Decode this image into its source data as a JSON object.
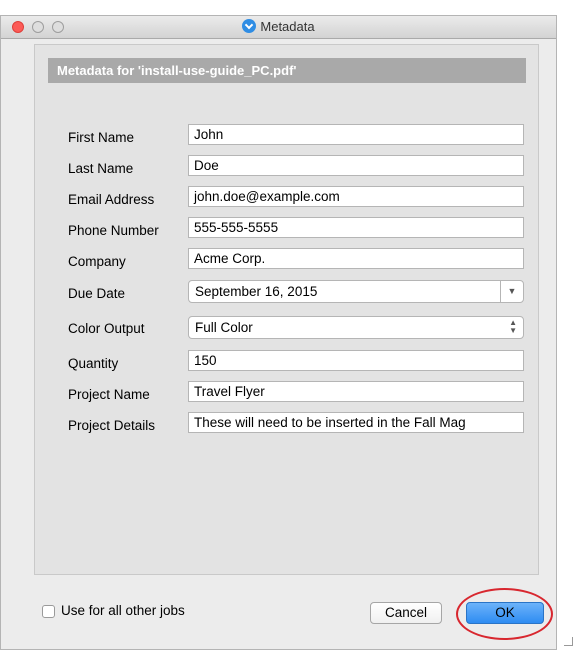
{
  "window": {
    "title": "Metadata"
  },
  "panel": {
    "header": "Metadata for 'install-use-guide_PC.pdf'"
  },
  "fields": {
    "first_name": {
      "label": "First Name",
      "value": "John"
    },
    "last_name": {
      "label": "Last Name",
      "value": "Doe"
    },
    "email": {
      "label": "Email Address",
      "value": "john.doe@example.com"
    },
    "phone": {
      "label": "Phone Number",
      "value": "555-555-5555"
    },
    "company": {
      "label": "Company",
      "value": "Acme Corp."
    },
    "due_date": {
      "label": "Due Date",
      "value": "September 16, 2015"
    },
    "color_output": {
      "label": "Color Output",
      "value": "Full Color"
    },
    "quantity": {
      "label": "Quantity",
      "value": "150"
    },
    "project_name": {
      "label": "Project Name",
      "value": "Travel Flyer"
    },
    "project_details": {
      "label": "Project Details",
      "value": "These will need to be inserted in the Fall Mag"
    }
  },
  "footer": {
    "checkbox_label": "Use for all other jobs",
    "checkbox_checked": false,
    "cancel_label": "Cancel",
    "ok_label": "OK"
  },
  "colors": {
    "highlight": "#d8272f",
    "ok_button": "#2e8cf2",
    "header_bar": "#a9a9a9"
  }
}
